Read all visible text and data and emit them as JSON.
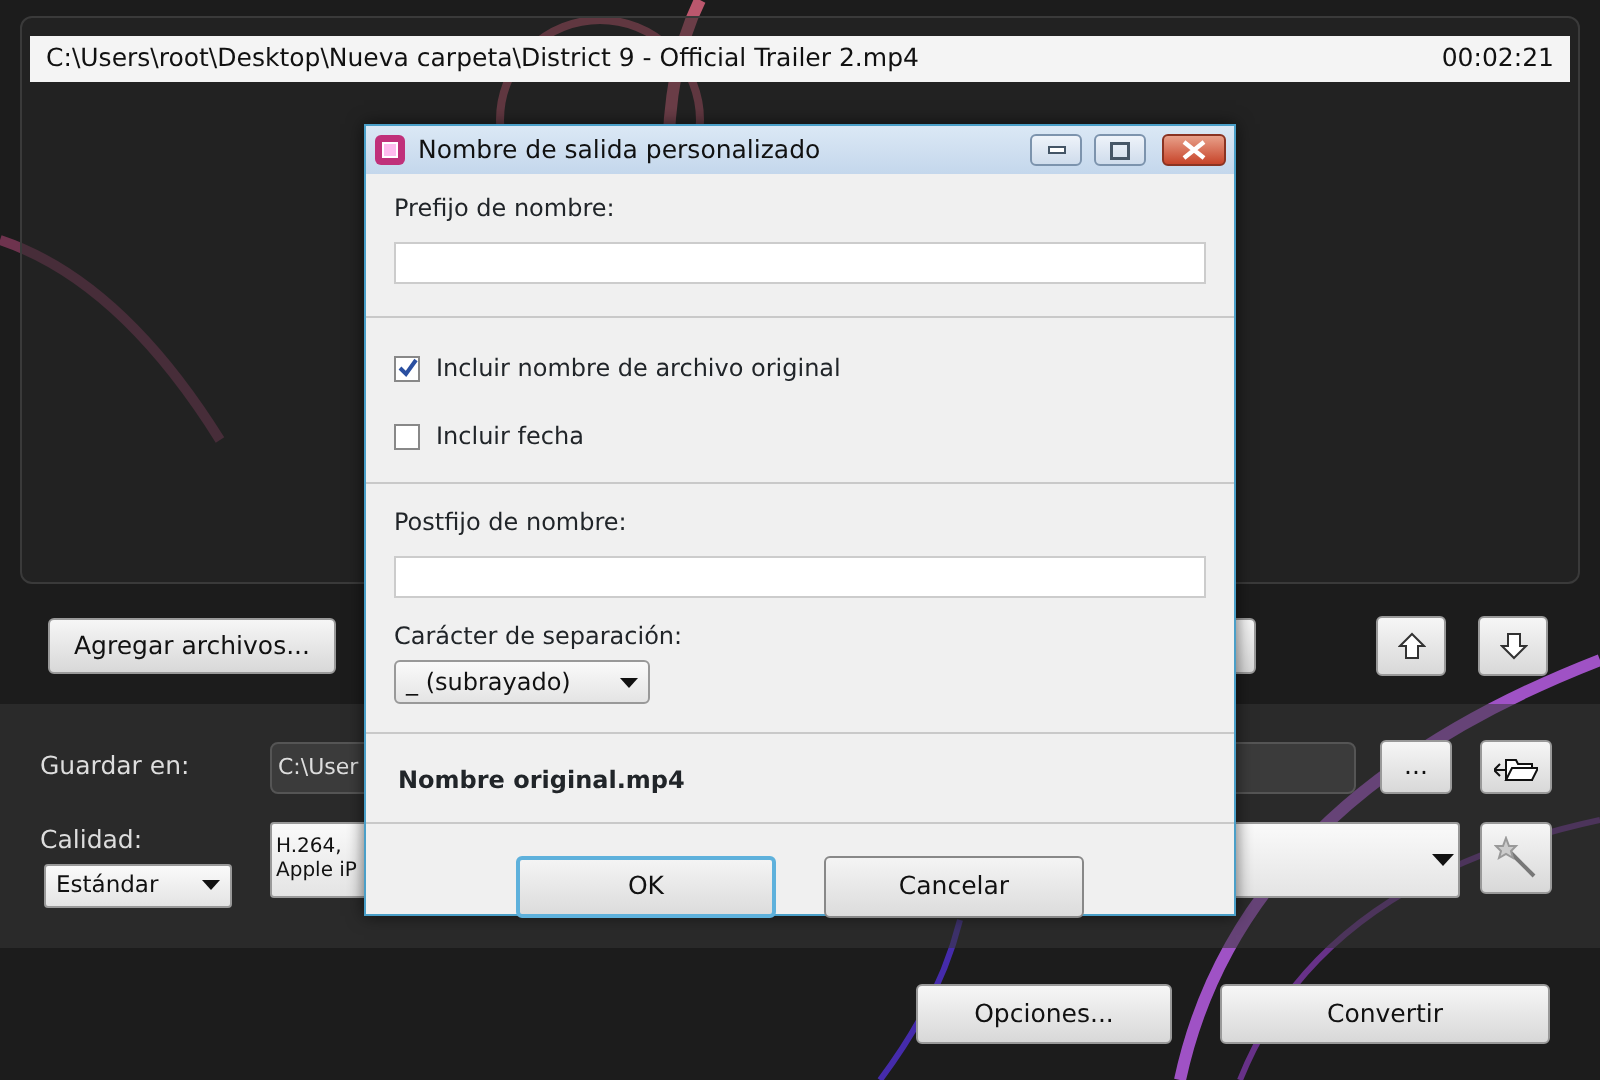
{
  "file_list": [
    {
      "path": "C:\\Users\\root\\Desktop\\Nueva carpeta\\District 9 - Official Trailer 2.mp4",
      "duration": "00:02:21",
      "selected": false
    }
  ],
  "add_button": "Agregar archivos...",
  "move_buttons": [
    {
      "kind": "up"
    },
    {
      "kind": "down"
    }
  ],
  "save": {
    "label": "Guardar en:",
    "value": "C:\\User",
    "browse": "..."
  },
  "quality": {
    "label": "Calidad:",
    "value": "Estándar",
    "profile_lines": [
      "H.264,",
      "Apple iP"
    ]
  },
  "bottom_buttons": [
    "Opciones...",
    "Convertir"
  ],
  "dialog": {
    "title": "Nombre de salida personalizado",
    "prefix_label": "Prefijo de nombre:",
    "options": [
      {
        "label": "Incluir nombre de archivo original",
        "checked": true
      },
      {
        "label": "Incluir fecha",
        "checked": false
      }
    ],
    "postfix_label": "Postfijo de nombre:",
    "separator_label": "Carácter de separación:",
    "separator_value": "_ (subrayado)",
    "preview": "Nombre original.mp4",
    "buttons": [
      {
        "label": "OK",
        "selected": true
      },
      {
        "label": "Cancelar",
        "selected": false
      }
    ]
  }
}
